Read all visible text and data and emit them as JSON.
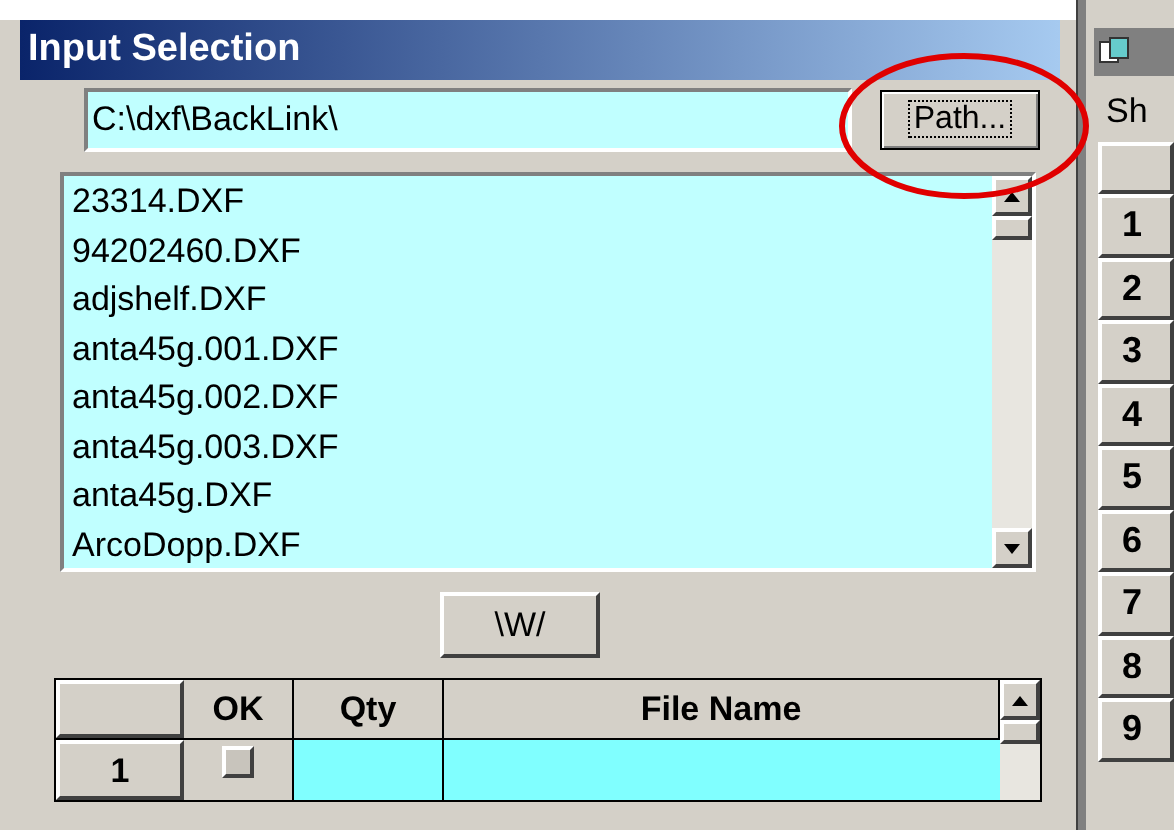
{
  "input_selection": {
    "title": "Input Selection",
    "path": "C:\\dxf\\BackLink\\",
    "path_button": "Path...",
    "files": [
      "23314.DXF",
      "94202460.DXF",
      "adjshelf.DXF",
      "anta45g.001.DXF",
      "anta45g.002.DXF",
      "anta45g.003.DXF",
      "anta45g.DXF",
      "ArcoDopp.DXF"
    ],
    "move_button": "\\W/",
    "grid": {
      "columns": [
        "OK",
        "Qty",
        "File Name"
      ],
      "rows": [
        {
          "label": "1",
          "ok": false
        }
      ]
    }
  },
  "side_panel": {
    "label": "Sh",
    "rows": [
      "1",
      "2",
      "3",
      "4",
      "5",
      "6",
      "7",
      "8",
      "9"
    ]
  }
}
